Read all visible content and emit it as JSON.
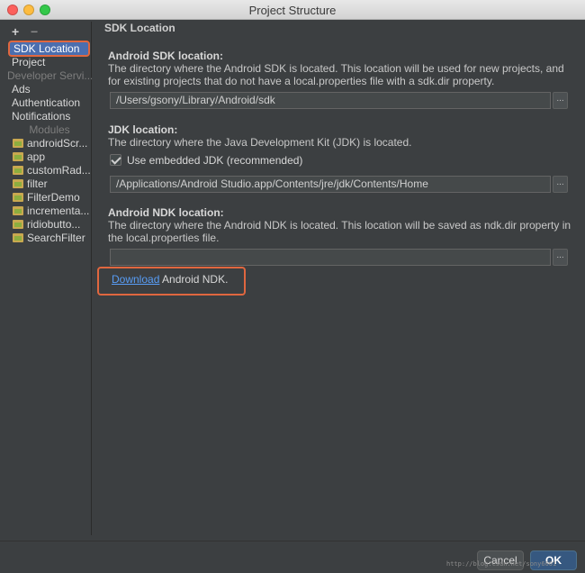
{
  "window": {
    "title": "Project Structure"
  },
  "toolbar": {
    "add_label": "+",
    "remove_label": "−"
  },
  "sidebar": {
    "sdk_location": "SDK Location",
    "project": "Project",
    "developer_services": "Developer Servi...",
    "ads": "Ads",
    "authentication": "Authentication",
    "notifications": "Notifications",
    "modules_label": "Modules",
    "modules": [
      "androidScr...",
      "app",
      "customRad...",
      "filter",
      "FilterDemo",
      "incrementa...",
      "ridiobutto...",
      "SearchFilter"
    ]
  },
  "main": {
    "section_title": "SDK Location",
    "android_sdk": {
      "heading": "Android SDK location:",
      "desc": "The directory where the Android SDK is located. This location will be used for new projects, and for existing projects that do not have a local.properties file with a sdk.dir property.",
      "path": "/Users/gsony/Library/Android/sdk"
    },
    "jdk": {
      "heading": "JDK location:",
      "desc": "The directory where the Java Development Kit (JDK) is located.",
      "checkbox_label": "Use embedded JDK (recommended)",
      "path": "/Applications/Android Studio.app/Contents/jre/jdk/Contents/Home"
    },
    "ndk": {
      "heading": "Android NDK location:",
      "desc": "The directory where the Android NDK is located. This location will be saved as ndk.dir property in the local.properties file.",
      "path": "",
      "download_link": "Download",
      "download_rest": " Android NDK."
    },
    "browse_label": "..."
  },
  "footer": {
    "cancel_label": "Cancel",
    "ok_label": "OK",
    "watermark": "http://blog.csdn.net/sony6001"
  },
  "colors": {
    "selection": "#4b6eaf",
    "highlight_border": "#e0673f",
    "link": "#589df6",
    "ok_button": "#365880"
  }
}
